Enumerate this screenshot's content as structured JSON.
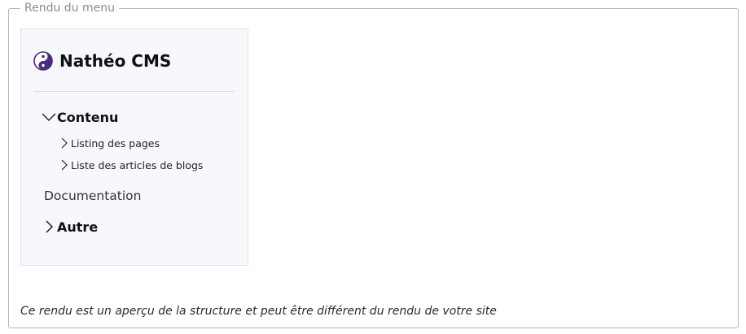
{
  "fieldset": {
    "legend": "Rendu du menu"
  },
  "menu": {
    "brand": {
      "label": "Nathéo CMS",
      "icon": "yin-yang-icon",
      "icon_color": "#4a2a7a"
    },
    "sections": [
      {
        "label": "Contenu",
        "expanded": true,
        "icon": "chevron-down-icon",
        "items": [
          {
            "label": "Listing des pages",
            "icon": "chevron-right-icon"
          },
          {
            "label": "Liste des articles de blogs",
            "icon": "chevron-right-icon"
          }
        ]
      },
      {
        "label": "Documentation"
      },
      {
        "label": "Autre",
        "expanded": false,
        "icon": "chevron-right-icon"
      }
    ]
  },
  "footnote": "Ce rendu est un aperçu de la structure et peut être différent du rendu de votre site",
  "colors": {
    "card_background": "#f7f8fb",
    "card_border": "#dfe2ea",
    "legend_text": "#8e8e8e"
  }
}
